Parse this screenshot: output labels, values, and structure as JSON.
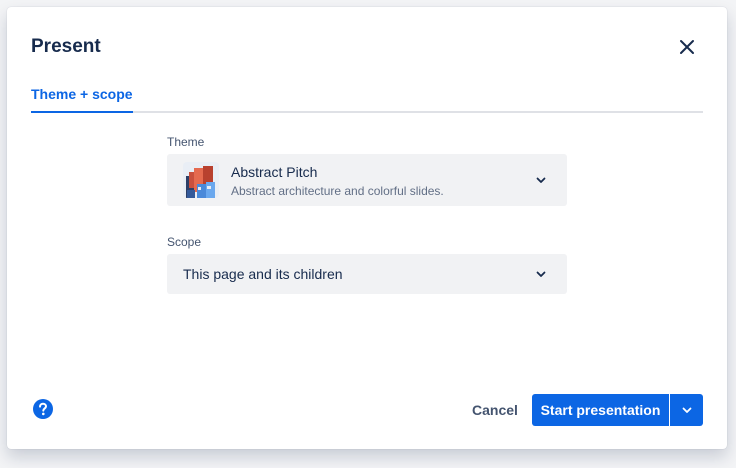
{
  "dialog": {
    "title": "Present",
    "close_icon": "close-icon"
  },
  "tabs": [
    {
      "label": "Theme + scope",
      "active": true
    }
  ],
  "theme": {
    "label": "Theme",
    "selected_name": "Abstract Pitch",
    "selected_description": "Abstract architecture and colorful slides.",
    "thumbnail_icon": "abstract-architecture-thumbnail",
    "dropdown_icon": "chevron-down-icon"
  },
  "scope": {
    "label": "Scope",
    "selected_value": "This page and its children",
    "dropdown_icon": "chevron-down-icon"
  },
  "footer": {
    "help_icon": "question-icon",
    "cancel_label": "Cancel",
    "start_label": "Start presentation",
    "split_icon": "chevron-down-icon"
  },
  "colors": {
    "accent": "#0c66e4",
    "text": "#172b4d",
    "subtle_text": "#626f86",
    "field_background": "#f1f2f4",
    "divider": "#dfe1e6"
  }
}
